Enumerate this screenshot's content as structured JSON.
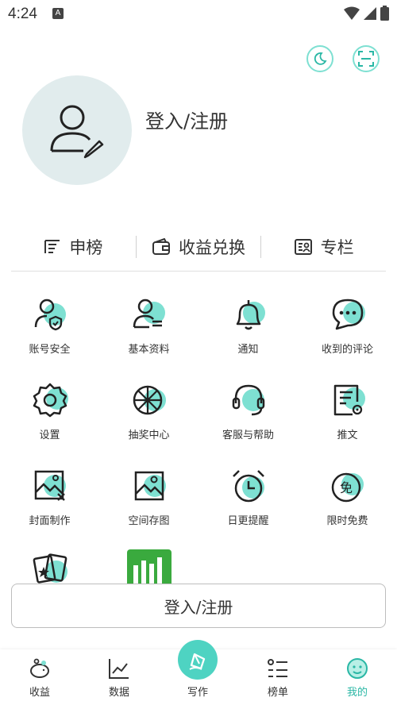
{
  "status": {
    "time": "4:24",
    "badge": "A"
  },
  "header": {
    "login_text": "登入/注册"
  },
  "quick": {
    "rank": "申榜",
    "exchange": "收益兑换",
    "column": "专栏"
  },
  "grid": {
    "account_security": "账号安全",
    "basic_info": "基本资料",
    "notify": "通知",
    "comments": "收到的评论",
    "settings": "设置",
    "lottery": "抽奖中心",
    "service": "客服与帮助",
    "promote": "推文",
    "cover": "封面制作",
    "storage": "空间存图",
    "reminder": "日更提醒",
    "free": "限时免费",
    "free_badge": "免"
  },
  "login_button": "登入/注册",
  "tabs": {
    "income": "收益",
    "data": "数据",
    "write": "写作",
    "rank": "榜单",
    "mine": "我的"
  },
  "colors": {
    "accent": "#4ed3c2",
    "active_text": "#2ab7a5",
    "avatar_bg": "#e1eced"
  }
}
